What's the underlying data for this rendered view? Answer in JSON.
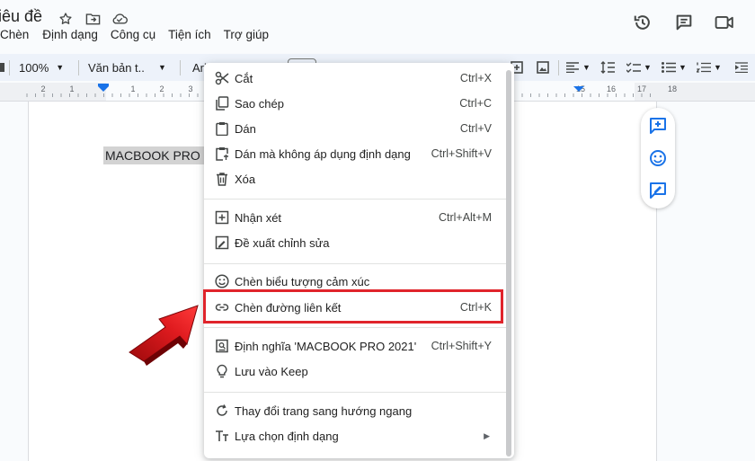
{
  "title_bar": {
    "doc_title": "iêu đề",
    "icons": [
      "star-icon",
      "folder-move-icon",
      "cloud-icon"
    ],
    "right_icons": [
      "history-icon",
      "comment-icon",
      "video-icon"
    ]
  },
  "menubar": [
    "Chèn",
    "Định dạng",
    "Công cụ",
    "Tiện ích",
    "Trợ giúp"
  ],
  "toolbar": {
    "zoom": "100%",
    "style": "Văn bản t...",
    "font": "Ari"
  },
  "ruler": {
    "numbers": [
      "2",
      "1",
      "1",
      "2",
      "3",
      "15",
      "16",
      "17",
      "18"
    ]
  },
  "document": {
    "selected_text": "MACBOOK PRO 2021"
  },
  "context_menu": {
    "items": [
      {
        "label": "Cắt",
        "shortcut": "Ctrl+X",
        "icon": "scissors-icon"
      },
      {
        "label": "Sao chép",
        "shortcut": "Ctrl+C",
        "icon": "copy-icon"
      },
      {
        "label": "Dán",
        "shortcut": "Ctrl+V",
        "icon": "clipboard-icon"
      },
      {
        "label": "Dán mà không áp dụng định dạng",
        "shortcut": "Ctrl+Shift+V",
        "icon": "paste-plain-icon"
      },
      {
        "label": "Xóa",
        "shortcut": "",
        "icon": "trash-icon"
      },
      {
        "label": "Nhận xét",
        "shortcut": "Ctrl+Alt+M",
        "icon": "add-comment-icon"
      },
      {
        "label": "Đề xuất chỉnh sửa",
        "shortcut": "",
        "icon": "suggest-edit-icon"
      },
      {
        "label": "Chèn biểu tượng cảm xúc",
        "shortcut": "",
        "icon": "emoji-icon"
      },
      {
        "label": "Chèn đường liên kết",
        "shortcut": "Ctrl+K",
        "icon": "link-icon"
      },
      {
        "label": "Định nghĩa 'MACBOOK PRO 2021'",
        "shortcut": "Ctrl+Shift+Y",
        "icon": "dictionary-icon"
      },
      {
        "label": "Lưu vào Keep",
        "shortcut": "",
        "icon": "lightbulb-icon"
      },
      {
        "label": "Thay đổi trang sang hướng ngang",
        "shortcut": "",
        "icon": "rotate-icon"
      },
      {
        "label": "Lựa chọn định dạng",
        "shortcut": "",
        "icon": "text-format-icon"
      }
    ]
  },
  "colors": {
    "highlight_box": "#e0242b",
    "accent": "#1a73e8",
    "toolbar_bg": "#edf2fa"
  }
}
